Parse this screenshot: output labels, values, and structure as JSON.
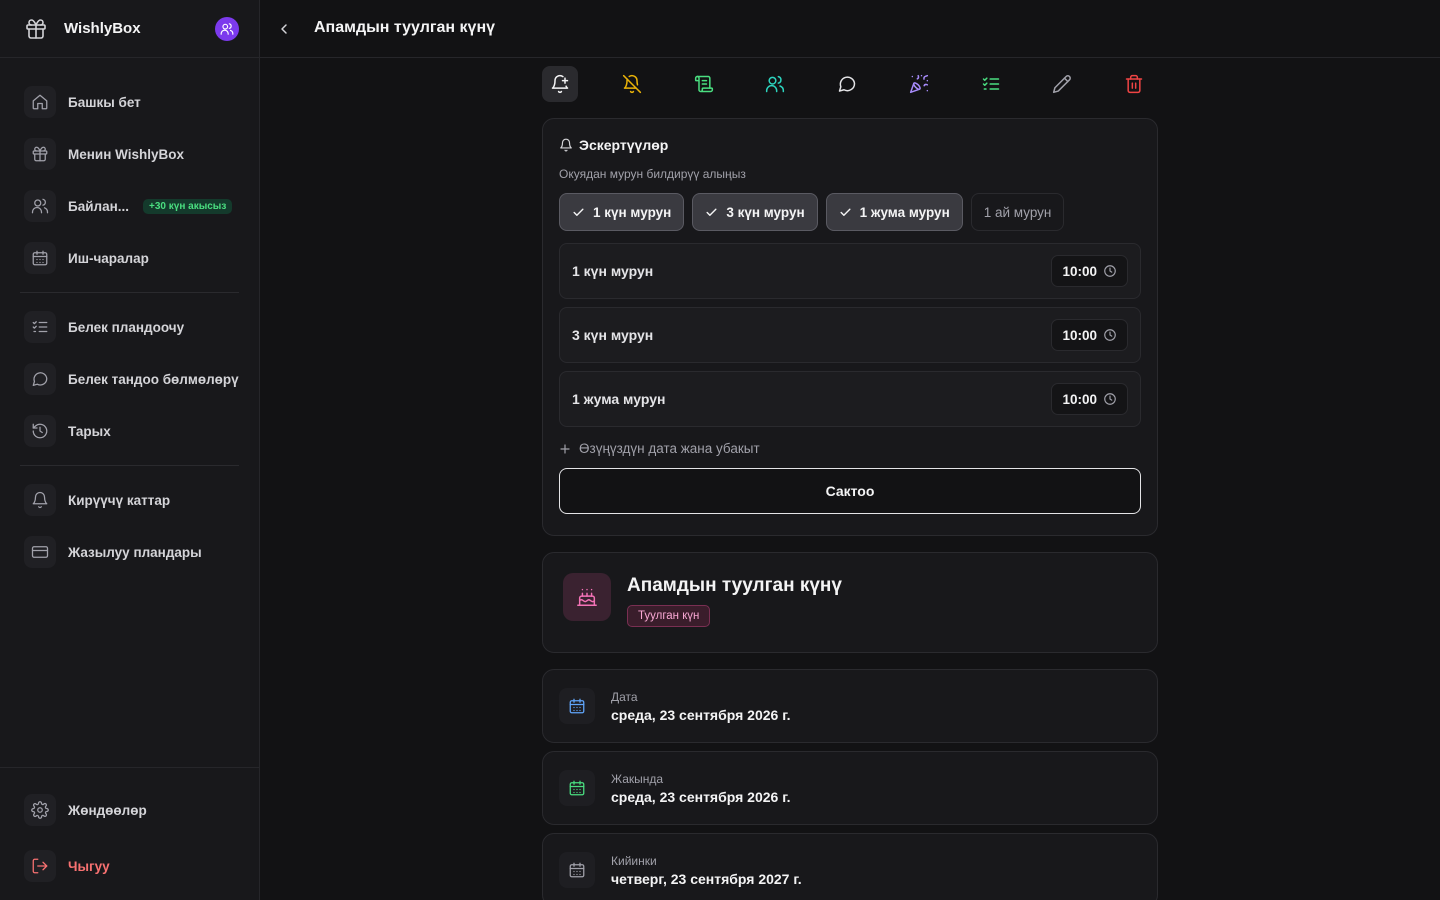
{
  "app": {
    "name": "WishlyBox"
  },
  "sidebar": {
    "items": [
      {
        "label": "Башкы бет",
        "icon": "home-icon"
      },
      {
        "label": "Менин WishlyBox",
        "icon": "gift-icon"
      },
      {
        "label": "Байлан...",
        "icon": "users-icon",
        "badge": "+30 күн акысыз"
      },
      {
        "label": "Иш-чаралар",
        "icon": "calendar-icon"
      },
      {
        "label": "Белек пландоочу",
        "icon": "list-checks-icon"
      },
      {
        "label": "Белек тандоо бөлмөлөрү",
        "icon": "message-circle-icon"
      },
      {
        "label": "Тарых",
        "icon": "history-icon"
      },
      {
        "label": "Кирүүчү каттар",
        "icon": "bell-icon"
      },
      {
        "label": "Жазылуу пландары",
        "icon": "credit-card-icon"
      }
    ],
    "settings": "Жөндөөлөр",
    "logout": "Чыгуу"
  },
  "header": {
    "title": "Апамдын туулган күнү"
  },
  "toolbar": {
    "buttons": [
      {
        "name": "add-reminder",
        "icon": "bell-plus-icon",
        "color": "#f4f4f5"
      },
      {
        "name": "mute",
        "icon": "bell-off-icon",
        "color": "#eab308"
      },
      {
        "name": "script",
        "icon": "scroll-icon",
        "color": "#4ade80"
      },
      {
        "name": "participants",
        "icon": "users-icon",
        "color": "#2dd4bf"
      },
      {
        "name": "chat",
        "icon": "message-circle-icon",
        "color": "#e4e4e7"
      },
      {
        "name": "celebrate",
        "icon": "party-popper-icon",
        "color": "#a78bfa"
      },
      {
        "name": "checklist",
        "icon": "list-checks-icon",
        "color": "#4ade80"
      },
      {
        "name": "edit",
        "icon": "pencil-icon",
        "color": "#a1a1aa"
      },
      {
        "name": "delete",
        "icon": "trash-icon",
        "color": "#ef4444"
      }
    ]
  },
  "reminders": {
    "title": "Эскертүүлөр",
    "subtitle": "Окуядан мурун билдирүү алыңыз",
    "chips": [
      {
        "label": "1 күн мурун",
        "selected": true
      },
      {
        "label": "3 күн мурун",
        "selected": true
      },
      {
        "label": "1 жума мурун",
        "selected": true
      },
      {
        "label": "1 ай мурун",
        "selected": false
      }
    ],
    "rows": [
      {
        "label": "1 күн мурун",
        "time": "10:00"
      },
      {
        "label": "3 күн мурун",
        "time": "10:00"
      },
      {
        "label": "1 жума мурун",
        "time": "10:00"
      }
    ],
    "add_custom": "Өзүңүздүн дата жана убакыт",
    "save": "Сактоо"
  },
  "event": {
    "title": "Апамдын туулган күнү",
    "tag": "Туулган күн",
    "icon": "cake-icon"
  },
  "info": [
    {
      "label": "Дата",
      "value": "среда, 23 сентября 2026 г.",
      "color": "#60a5fa"
    },
    {
      "label": "Жакында",
      "value": "среда, 23 сентября 2026 г.",
      "color": "#4ade80"
    },
    {
      "label": "Кийинки",
      "value": "четверг, 23 сентября 2027 г.",
      "color": "#a1a1aa"
    }
  ]
}
